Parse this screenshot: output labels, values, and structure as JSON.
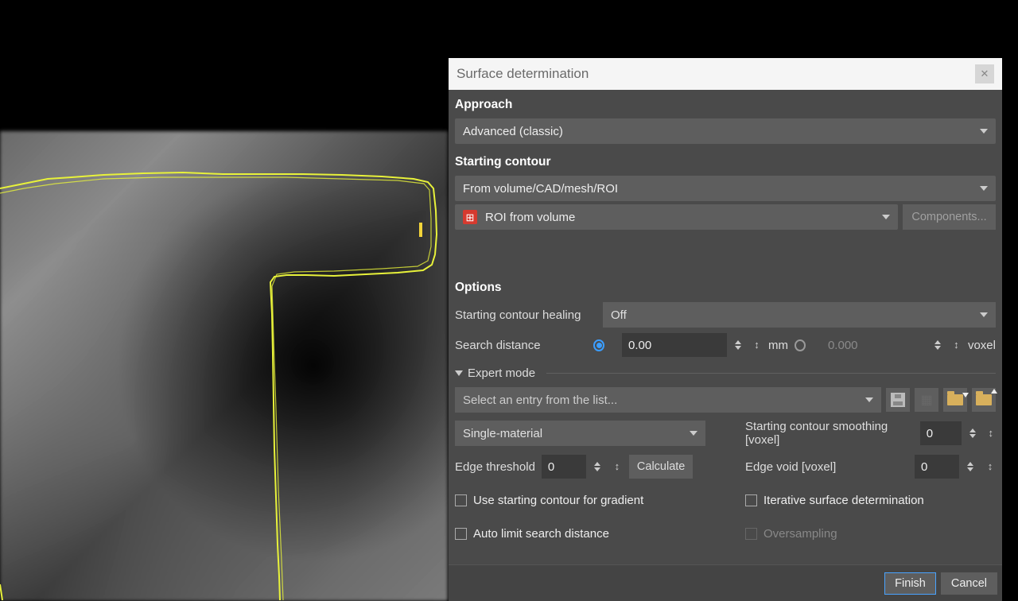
{
  "dialog": {
    "title": "Surface determination",
    "approach_label": "Approach",
    "approach_value": "Advanced (classic)",
    "starting_contour_label": "Starting contour",
    "starting_contour_value": "From volume/CAD/mesh/ROI",
    "roi_value": "ROI from volume",
    "components_label": "Components...",
    "options_label": "Options",
    "healing_label": "Starting contour healing",
    "healing_value": "Off",
    "search_distance_label": "Search distance",
    "search_distance_mm": "0.00",
    "search_distance_voxel": "0.000",
    "unit_mm": "mm",
    "unit_voxel": "voxel",
    "expert_label": "Expert mode",
    "list_placeholder": "Select an entry from the list...",
    "material_value": "Single-material",
    "edge_threshold_label": "Edge threshold",
    "edge_threshold_value": "0",
    "calculate_label": "Calculate",
    "smoothing_label": "Starting contour smoothing [voxel]",
    "smoothing_value": "0",
    "edge_void_label": "Edge void [voxel]",
    "edge_void_value": "0",
    "chk_gradient": "Use starting contour for gradient",
    "chk_autolimit": "Auto limit search distance",
    "chk_iterative": "Iterative surface determination",
    "chk_oversampling": "Oversampling",
    "finish_label": "Finish",
    "cancel_label": "Cancel"
  }
}
